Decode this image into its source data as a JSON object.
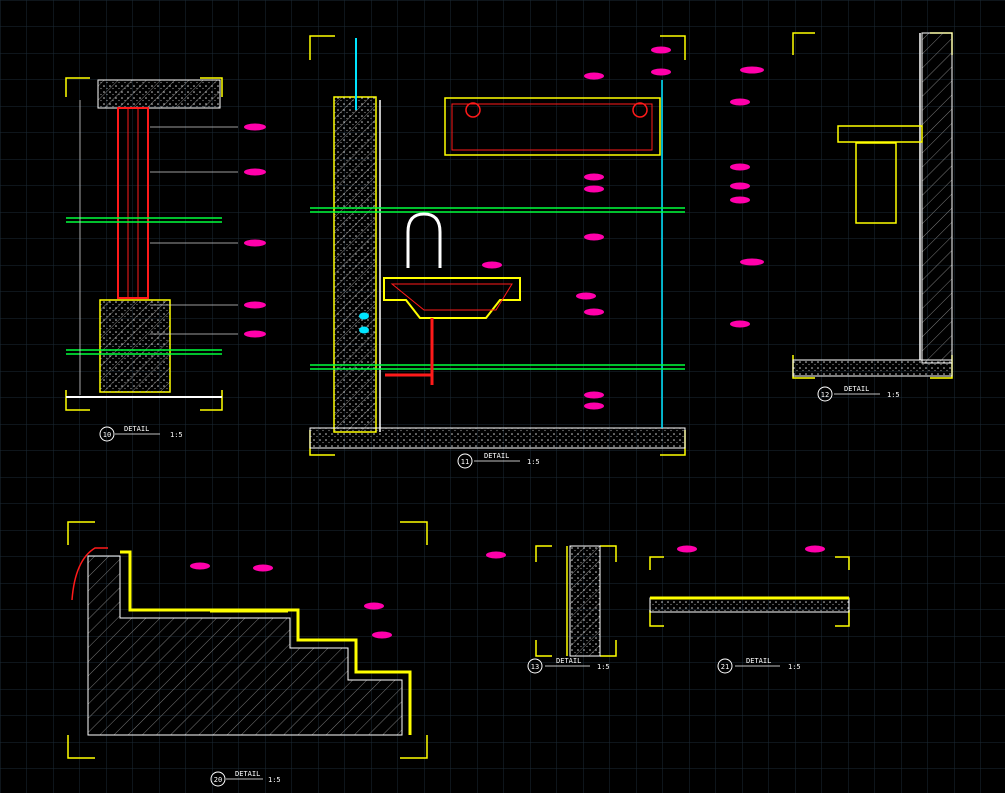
{
  "colors": {
    "background": "#000000",
    "grid": "#1b2a36",
    "frame": "#ffff00",
    "wall": "#ffffff",
    "hatch": "#8c8c8c",
    "pipe_green": "#00ff3c",
    "red": "#ff1a1a",
    "magenta": "#ff00aa",
    "cyan": "#00e5ff",
    "text_white": "#ffffff"
  },
  "details": [
    {
      "id": "10",
      "title": "DETAIL",
      "scale": "1:5"
    },
    {
      "id": "11",
      "title": "DETAIL",
      "scale": "1:5"
    },
    {
      "id": "12",
      "title": "DETAIL",
      "scale": "1:5"
    },
    {
      "id": "13",
      "title": "DETAIL",
      "scale": "1:5"
    },
    {
      "id": "20",
      "title": "DETAIL",
      "scale": "1:5"
    },
    {
      "id": "21",
      "title": "DETAIL",
      "scale": "1:5"
    }
  ]
}
